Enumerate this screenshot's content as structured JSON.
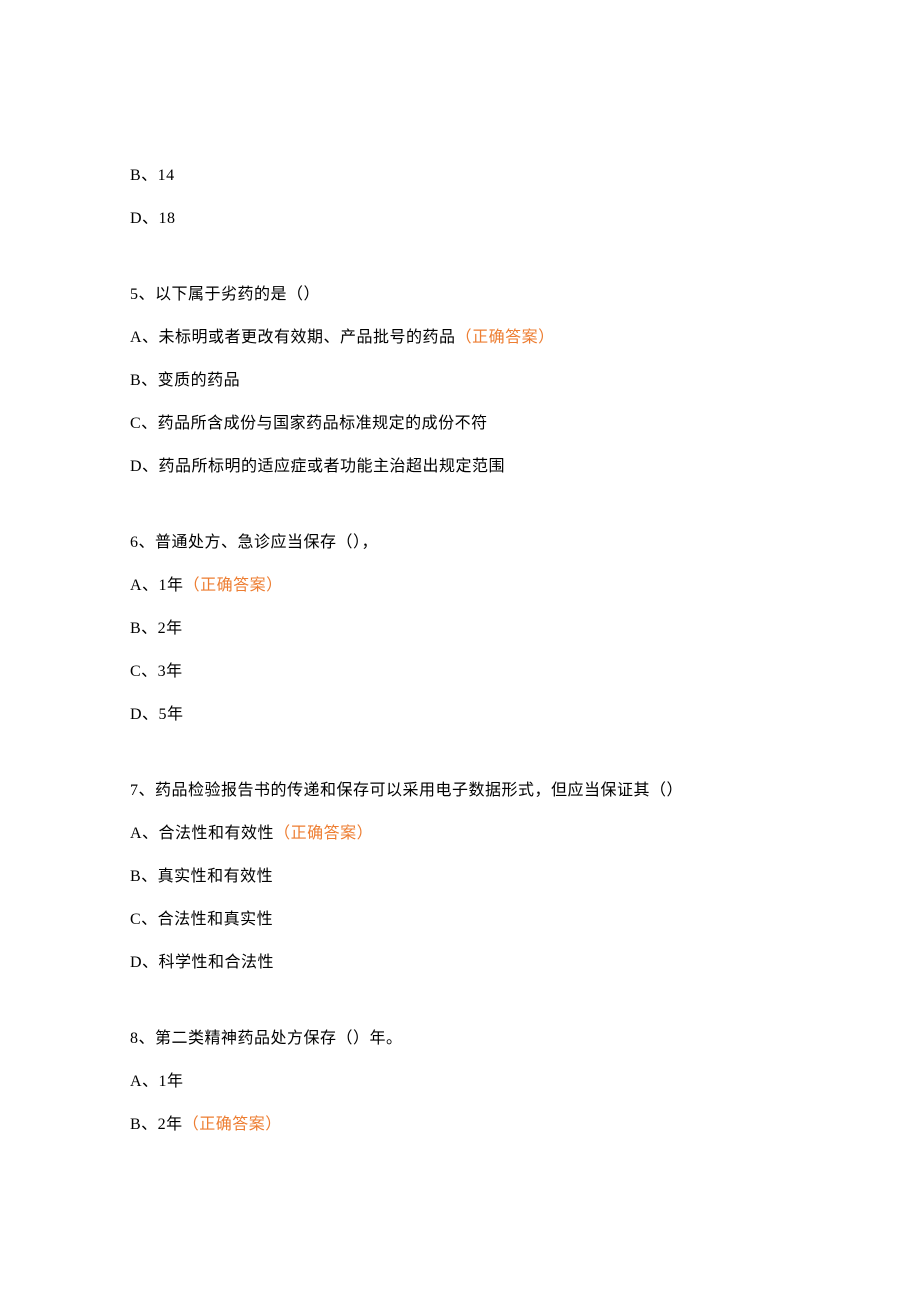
{
  "correctLabel": "（正确答案）",
  "lines": [
    {
      "text": "B、14",
      "questionStart": false,
      "correct": false
    },
    {
      "text": "D、18",
      "questionStart": false,
      "correct": false
    },
    {
      "text": "5、以下属于劣药的是（）",
      "questionStart": true,
      "correct": false
    },
    {
      "text": "A、未标明或者更改有效期、产品批号的药品",
      "questionStart": false,
      "correct": true
    },
    {
      "text": "B、变质的药品",
      "questionStart": false,
      "correct": false
    },
    {
      "text": "C、药品所含成份与国家药品标准规定的成份不符",
      "questionStart": false,
      "correct": false
    },
    {
      "text": "D、药品所标明的适应症或者功能主治超出规定范围",
      "questionStart": false,
      "correct": false
    },
    {
      "text": "6、普通处方、急诊应当保存（），",
      "questionStart": true,
      "correct": false
    },
    {
      "text": "A、1年",
      "questionStart": false,
      "correct": true
    },
    {
      "text": "B、2年",
      "questionStart": false,
      "correct": false
    },
    {
      "text": "C、3年",
      "questionStart": false,
      "correct": false
    },
    {
      "text": "D、5年",
      "questionStart": false,
      "correct": false
    },
    {
      "text": "7、药品检验报告书的传递和保存可以采用电子数据形式，但应当保证其（）",
      "questionStart": true,
      "correct": false
    },
    {
      "text": "A、合法性和有效性",
      "questionStart": false,
      "correct": true
    },
    {
      "text": "B、真实性和有效性",
      "questionStart": false,
      "correct": false
    },
    {
      "text": "C、合法性和真实性",
      "questionStart": false,
      "correct": false
    },
    {
      "text": "D、科学性和合法性",
      "questionStart": false,
      "correct": false
    },
    {
      "text": "8、第二类精神药品处方保存（）年。",
      "questionStart": true,
      "correct": false
    },
    {
      "text": "A、1年",
      "questionStart": false,
      "correct": false
    },
    {
      "text": "B、2年",
      "questionStart": false,
      "correct": true
    }
  ]
}
